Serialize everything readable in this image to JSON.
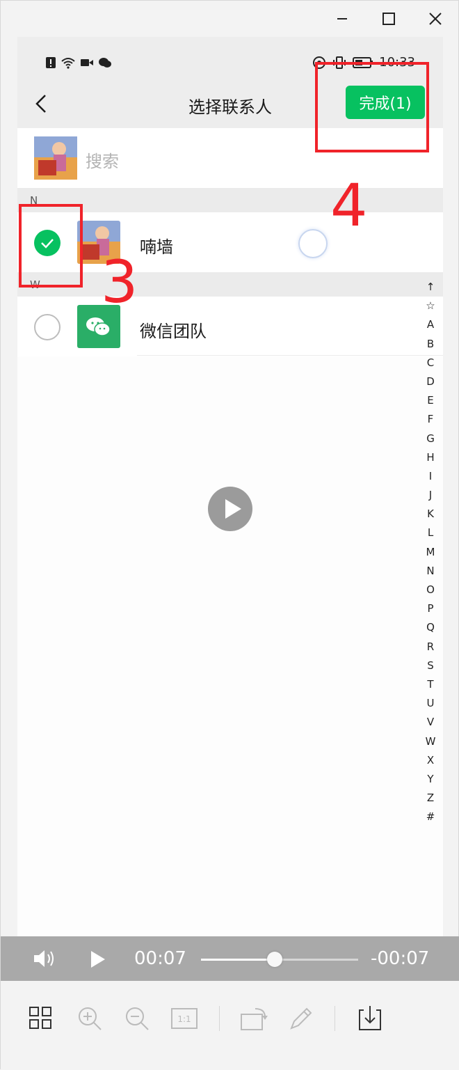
{
  "window": {
    "controls": [
      "minimize",
      "maximize",
      "close"
    ]
  },
  "statusbar": {
    "time": "10:33",
    "left_icons": [
      "alert-icon",
      "wifi-icon",
      "video-icon",
      "wechat-icon"
    ],
    "right_icons": [
      "eye-icon",
      "vibrate-icon",
      "battery-icon"
    ]
  },
  "header": {
    "back_icon": "chevron-left-icon",
    "title": "选择联系人",
    "done_label": "完成(1)"
  },
  "search": {
    "placeholder": "搜索"
  },
  "sections": [
    {
      "letter": "N",
      "contacts": [
        {
          "name": "喃墙",
          "checked": true
        }
      ]
    },
    {
      "letter": "W",
      "contacts": [
        {
          "name": "微信团队",
          "checked": false
        }
      ]
    }
  ],
  "index_letters": [
    "↑",
    "☆",
    "A",
    "B",
    "C",
    "D",
    "E",
    "F",
    "G",
    "H",
    "I",
    "J",
    "K",
    "L",
    "M",
    "N",
    "O",
    "P",
    "Q",
    "R",
    "S",
    "T",
    "U",
    "V",
    "W",
    "X",
    "Y",
    "Z",
    "#"
  ],
  "annotations": {
    "step_a": "3",
    "step_b": "4",
    "color": "#f0232a"
  },
  "player": {
    "elapsed": "00:07",
    "remaining": "-00:07",
    "progress": 0.47
  },
  "toolbar": {
    "icons": [
      "grid-icon",
      "zoom-in-icon",
      "zoom-out-icon",
      "actual-size-icon",
      "rotate-icon",
      "edit-icon",
      "download-icon"
    ],
    "actual_size_label": "1:1"
  },
  "colors": {
    "accent": "#07c160",
    "annotation": "#f0232a"
  }
}
